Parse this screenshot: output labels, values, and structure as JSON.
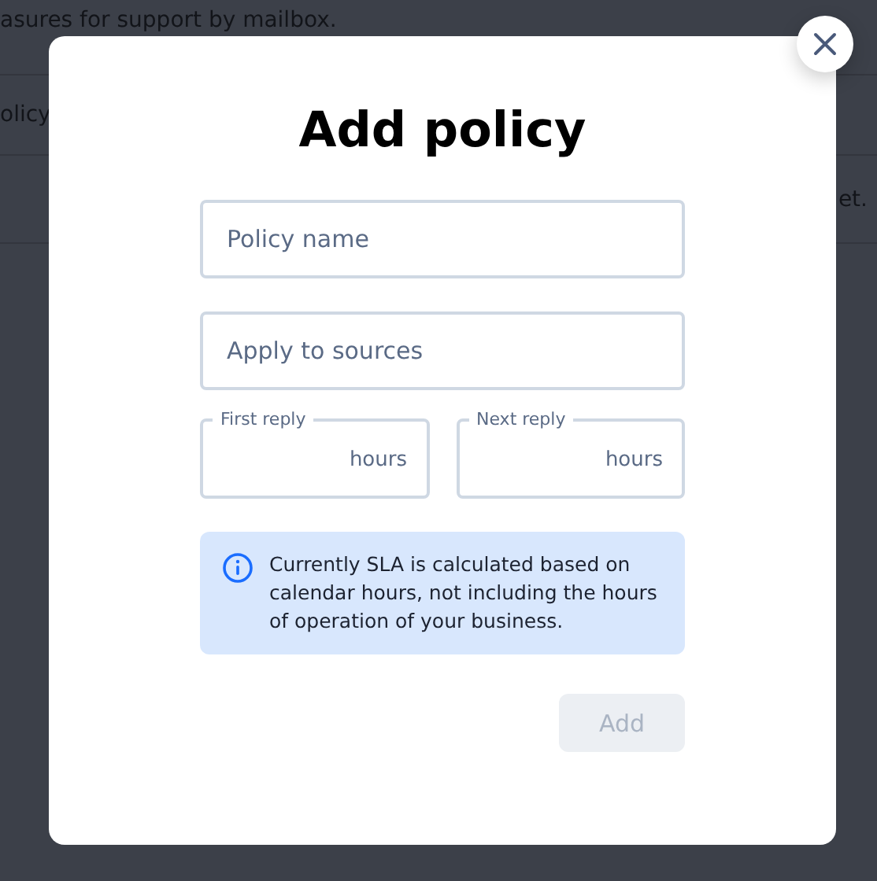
{
  "background_page": {
    "description_end": "asures for support by mailbox.",
    "row_1_text": "olicy",
    "row_2_text": "et."
  },
  "modal": {
    "title": "Add policy",
    "fields": [
      {
        "placeholder": "Policy name"
      },
      {
        "placeholder": "Apply to sources"
      }
    ],
    "reply_fields": [
      {
        "label": "First reply",
        "unit": "hours"
      },
      {
        "label": "Next reply",
        "unit": "hours"
      }
    ],
    "info": "Currently SLA is calculated based on calendar hours, not including the hours of operation of your business.",
    "add_button": {
      "label": "Add",
      "disabled": true
    }
  }
}
